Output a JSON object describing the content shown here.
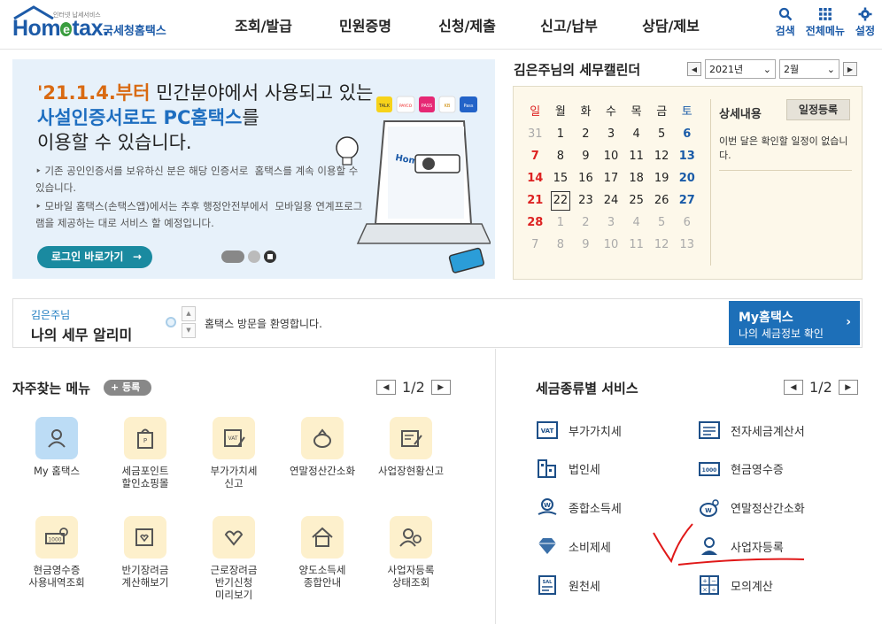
{
  "header": {
    "logo_tiny": "인터넷 납세서비스",
    "logo_main": "Hom",
    "logo_e": "e",
    "logo_tail": "tax.",
    "logo_sub": "국세청홈택스",
    "nav": [
      "조회/발급",
      "민원증명",
      "신청/제출",
      "신고/납부",
      "상담/제보"
    ],
    "util": {
      "search": "검색",
      "allmenu": "전체메뉴",
      "settings": "설정"
    }
  },
  "banner": {
    "line1_hl": "'21.1.4.부터",
    "line1_rest": " 민간분야에서 사용되고 있는",
    "line2_hl": "사설인증서로도 PC홈택스",
    "line2_rest": "를",
    "line3": "이용할 수 있습니다.",
    "bullet1": "‣ 기존 공인인증서를 보유하신 분은 해당 인증서로  홈택스를 계속 이용할 수 있습니다.",
    "bullet2": "‣ 모바일 홈택스(손택스앱)에서는 추후 행정안전부에서  모바일용 연계프로그램을 제공하는 대로 서비스 할 예정입니다.",
    "button": "로그인 바로가기",
    "button_arrow": "→",
    "badges": [
      "TALK",
      "PAYCO",
      "PASS",
      "KB",
      "Pass"
    ],
    "laptop_text": "Hometax"
  },
  "calendar": {
    "title": "김은주님의 세무캘린더",
    "year": "2021년",
    "month": "2월",
    "weekdays": [
      "일",
      "월",
      "화",
      "수",
      "목",
      "금",
      "토"
    ],
    "weeks": [
      [
        "31",
        "1",
        "2",
        "3",
        "4",
        "5",
        "6"
      ],
      [
        "7",
        "8",
        "9",
        "10",
        "11",
        "12",
        "13"
      ],
      [
        "14",
        "15",
        "16",
        "17",
        "18",
        "19",
        "20"
      ],
      [
        "21",
        "22",
        "23",
        "24",
        "25",
        "26",
        "27"
      ],
      [
        "28",
        "1",
        "2",
        "3",
        "4",
        "5",
        "6"
      ],
      [
        "7",
        "8",
        "9",
        "10",
        "11",
        "12",
        "13"
      ]
    ],
    "detail_title": "상세내용",
    "add_button": "일정등록",
    "detail_text": "이번 달은 확인할 일정이 없습니다."
  },
  "notice": {
    "user": "김은주님",
    "title": "나의 세무 알리미",
    "message": "홈택스 방문을 환영합니다.",
    "up": "▲",
    "down": "▼",
    "my_title": "My홈택스",
    "my_sub": "나의 세금정보 확인",
    "my_arrow": "›"
  },
  "favorites": {
    "title": "자주찾는 메뉴",
    "add": "+ 등록",
    "page": "1/2",
    "prev": "◀",
    "next": "▶",
    "items": [
      "My 홈택스",
      "세금포인트\n할인쇼핑몰",
      "부가가치세\n신고",
      "연말정산간소화",
      "사업장현황신고",
      "현금영수증\n사용내역조회",
      "반기장려금\n계산해보기",
      "근로장려금\n반기신청\n미리보기",
      "양도소득세\n종합안내",
      "사업자등록\n상태조회"
    ]
  },
  "tax_services": {
    "title": "세금종류별 서비스",
    "page": "1/2",
    "prev": "◀",
    "next": "▶",
    "left": [
      "부가가치세",
      "법인세",
      "종합소득세",
      "소비제세",
      "원천세"
    ],
    "right": [
      "전자세금계산서",
      "현금영수증",
      "연말정산간소화",
      "사업자등록",
      "모의계산"
    ]
  },
  "colors": {
    "brand_blue": "#1d5ba8",
    "banner_bg": "#e7f1fa",
    "highlight_orange": "#d96a12",
    "calendar_bg": "#fdf8ea",
    "myhome_blue": "#1d6fb8",
    "annotation_red": "#e01818"
  }
}
